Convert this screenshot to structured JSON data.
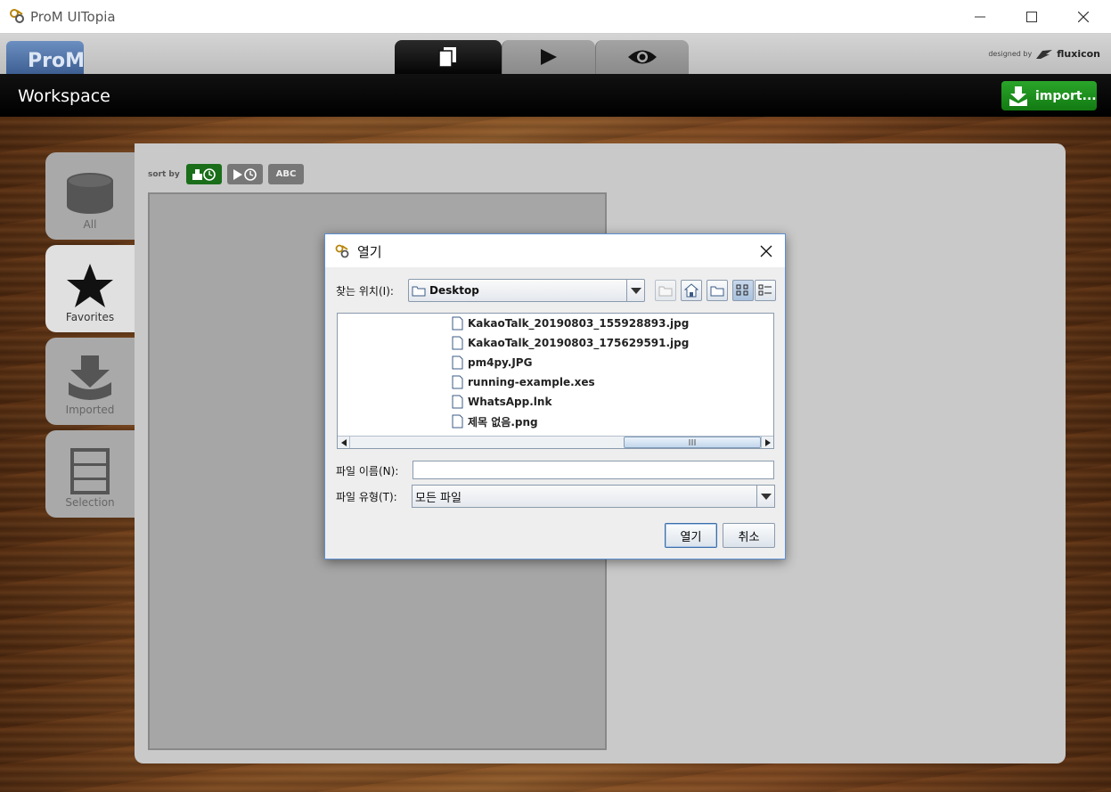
{
  "window": {
    "title": "ProM UITopia"
  },
  "logo": {
    "text": "ProM"
  },
  "branding": {
    "designed_by": "designed by",
    "company": "fluxicon"
  },
  "header": {
    "title": "Workspace",
    "import_label": "import..."
  },
  "sidebar": {
    "items": [
      {
        "label": "All",
        "icon": "database-icon"
      },
      {
        "label": "Favorites",
        "icon": "star-icon"
      },
      {
        "label": "Imported",
        "icon": "import-icon"
      },
      {
        "label": "Selection",
        "icon": "selection-icon"
      }
    ]
  },
  "sort": {
    "label": "sort by",
    "abc_label": "ABC"
  },
  "dialog": {
    "title": "열기",
    "look_in_label": "찾는 위치(I):",
    "look_in_value": "Desktop",
    "files": [
      "KakaoTalk_20190803_155928893.jpg",
      "KakaoTalk_20190803_175629591.jpg",
      "pm4py.JPG",
      "running-example.xes",
      "WhatsApp.lnk",
      "제목 없음.png"
    ],
    "file_name_label": "파일 이름(N):",
    "file_name_value": "",
    "file_type_label": "파일 유형(T):",
    "file_type_value": "모든 파일",
    "open_label": "열기",
    "cancel_label": "취소"
  },
  "colors": {
    "accent_green": "#1e8e1e",
    "dialog_border": "#5d8fcf",
    "header_black": "#000000"
  }
}
